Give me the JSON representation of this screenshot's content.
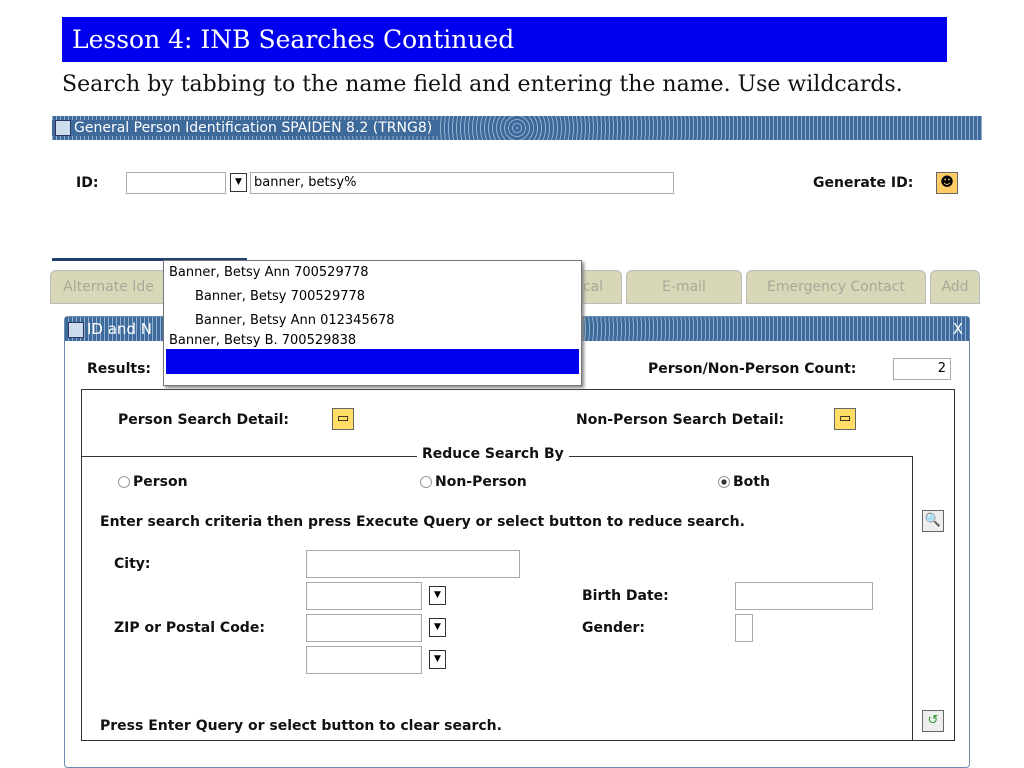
{
  "lesson_title": "Lesson 4: INB Searches Continued",
  "instruction": "Search by tabbing to the name field and entering the name. Use wildcards.",
  "form": {
    "title": "General Person Identification  SPAIDEN  8.2  (TRNG8)",
    "id_label": "ID:",
    "id_value": "",
    "name_value": "banner, betsy%",
    "generate_id_label": "Generate ID:"
  },
  "tabs": [
    "Alternate Ide",
    "ical",
    "E-mail",
    "Emergency Contact",
    "Add"
  ],
  "popup": {
    "items": [
      "Banner, Betsy Ann 700529778",
      "Banner, Betsy 700529778",
      "Banner, Betsy Ann 012345678",
      "Banner, Betsy B. 700529838"
    ]
  },
  "dialog": {
    "title": "ID and N",
    "close": "X",
    "results_label": "Results:",
    "count_label": "Person/Non-Person Count:",
    "count_value": "2",
    "person_detail": "Person Search Detail:",
    "nonperson_detail": "Non-Person Search Detail:",
    "reduce_by": "Reduce Search By",
    "radio_person": "Person",
    "radio_nonperson": "Non-Person",
    "radio_both": "Both",
    "enter_criteria": "Enter search criteria then press Execute Query or select button to reduce search.",
    "city_label": "City:",
    "zip_label": "ZIP or Postal Code:",
    "birth_label": "Birth Date:",
    "gender_label": "Gender:",
    "clear_text": "Press Enter Query or select button to clear search."
  }
}
